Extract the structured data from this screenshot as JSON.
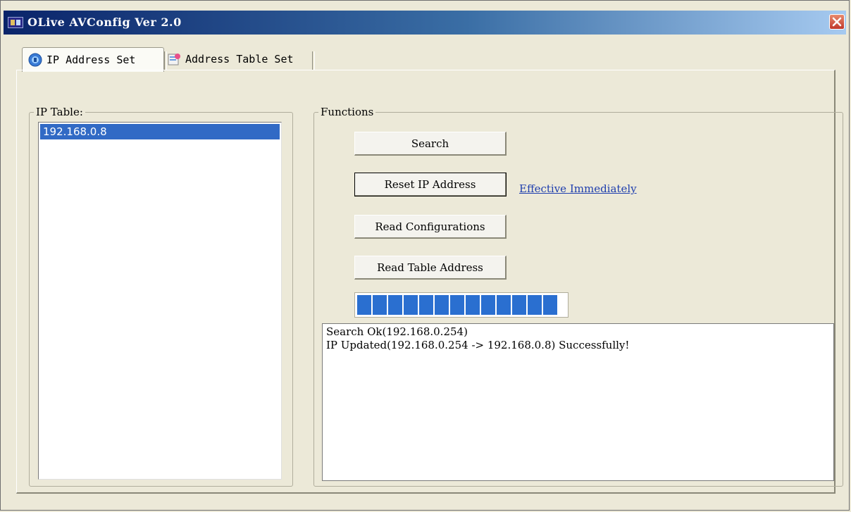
{
  "window": {
    "title": "OLive AVConfig Ver 2.0"
  },
  "tabs": [
    {
      "label": "IP Address Set",
      "icon": "ip-address-icon",
      "active": true
    },
    {
      "label": "Address Table Set",
      "icon": "address-table-icon",
      "active": false
    }
  ],
  "ip_table": {
    "title": "IP Table:",
    "items": [
      "192.168.0.8"
    ],
    "selected_index": 0
  },
  "functions": {
    "title": "Functions",
    "buttons": {
      "search": "Search",
      "reset_ip": "Reset IP Address",
      "read_config": "Read Configurations",
      "read_table": "Read Table Address"
    },
    "link": "Effective Immediately",
    "progress": 1.0,
    "log": [
      "Search Ok(192.168.0.254)",
      "IP Updated(192.168.0.254 -> 192.168.0.8) Successfully!"
    ]
  },
  "colors": {
    "title_bar_start": "#0a246a",
    "selection": "#316ac5",
    "progress": "#2a6fd0",
    "link": "#1f3fae"
  }
}
